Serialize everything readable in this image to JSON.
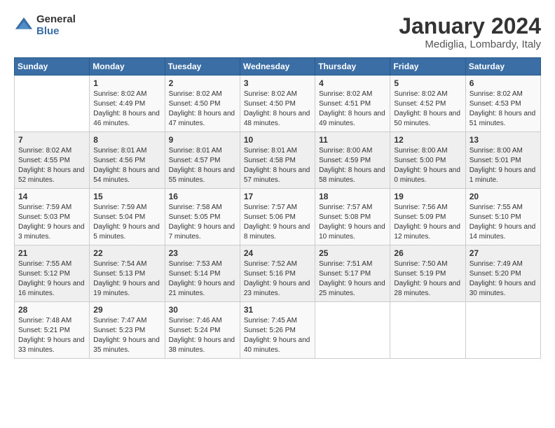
{
  "logo": {
    "general": "General",
    "blue": "Blue"
  },
  "header": {
    "month": "January 2024",
    "location": "Mediglia, Lombardy, Italy"
  },
  "weekdays": [
    "Sunday",
    "Monday",
    "Tuesday",
    "Wednesday",
    "Thursday",
    "Friday",
    "Saturday"
  ],
  "weeks": [
    [
      {
        "day": "",
        "sunrise": "",
        "sunset": "",
        "daylight": ""
      },
      {
        "day": "1",
        "sunrise": "Sunrise: 8:02 AM",
        "sunset": "Sunset: 4:49 PM",
        "daylight": "Daylight: 8 hours and 46 minutes."
      },
      {
        "day": "2",
        "sunrise": "Sunrise: 8:02 AM",
        "sunset": "Sunset: 4:50 PM",
        "daylight": "Daylight: 8 hours and 47 minutes."
      },
      {
        "day": "3",
        "sunrise": "Sunrise: 8:02 AM",
        "sunset": "Sunset: 4:50 PM",
        "daylight": "Daylight: 8 hours and 48 minutes."
      },
      {
        "day": "4",
        "sunrise": "Sunrise: 8:02 AM",
        "sunset": "Sunset: 4:51 PM",
        "daylight": "Daylight: 8 hours and 49 minutes."
      },
      {
        "day": "5",
        "sunrise": "Sunrise: 8:02 AM",
        "sunset": "Sunset: 4:52 PM",
        "daylight": "Daylight: 8 hours and 50 minutes."
      },
      {
        "day": "6",
        "sunrise": "Sunrise: 8:02 AM",
        "sunset": "Sunset: 4:53 PM",
        "daylight": "Daylight: 8 hours and 51 minutes."
      }
    ],
    [
      {
        "day": "7",
        "sunrise": "Sunrise: 8:02 AM",
        "sunset": "Sunset: 4:55 PM",
        "daylight": "Daylight: 8 hours and 52 minutes."
      },
      {
        "day": "8",
        "sunrise": "Sunrise: 8:01 AM",
        "sunset": "Sunset: 4:56 PM",
        "daylight": "Daylight: 8 hours and 54 minutes."
      },
      {
        "day": "9",
        "sunrise": "Sunrise: 8:01 AM",
        "sunset": "Sunset: 4:57 PM",
        "daylight": "Daylight: 8 hours and 55 minutes."
      },
      {
        "day": "10",
        "sunrise": "Sunrise: 8:01 AM",
        "sunset": "Sunset: 4:58 PM",
        "daylight": "Daylight: 8 hours and 57 minutes."
      },
      {
        "day": "11",
        "sunrise": "Sunrise: 8:00 AM",
        "sunset": "Sunset: 4:59 PM",
        "daylight": "Daylight: 8 hours and 58 minutes."
      },
      {
        "day": "12",
        "sunrise": "Sunrise: 8:00 AM",
        "sunset": "Sunset: 5:00 PM",
        "daylight": "Daylight: 9 hours and 0 minutes."
      },
      {
        "day": "13",
        "sunrise": "Sunrise: 8:00 AM",
        "sunset": "Sunset: 5:01 PM",
        "daylight": "Daylight: 9 hours and 1 minute."
      }
    ],
    [
      {
        "day": "14",
        "sunrise": "Sunrise: 7:59 AM",
        "sunset": "Sunset: 5:03 PM",
        "daylight": "Daylight: 9 hours and 3 minutes."
      },
      {
        "day": "15",
        "sunrise": "Sunrise: 7:59 AM",
        "sunset": "Sunset: 5:04 PM",
        "daylight": "Daylight: 9 hours and 5 minutes."
      },
      {
        "day": "16",
        "sunrise": "Sunrise: 7:58 AM",
        "sunset": "Sunset: 5:05 PM",
        "daylight": "Daylight: 9 hours and 7 minutes."
      },
      {
        "day": "17",
        "sunrise": "Sunrise: 7:57 AM",
        "sunset": "Sunset: 5:06 PM",
        "daylight": "Daylight: 9 hours and 8 minutes."
      },
      {
        "day": "18",
        "sunrise": "Sunrise: 7:57 AM",
        "sunset": "Sunset: 5:08 PM",
        "daylight": "Daylight: 9 hours and 10 minutes."
      },
      {
        "day": "19",
        "sunrise": "Sunrise: 7:56 AM",
        "sunset": "Sunset: 5:09 PM",
        "daylight": "Daylight: 9 hours and 12 minutes."
      },
      {
        "day": "20",
        "sunrise": "Sunrise: 7:55 AM",
        "sunset": "Sunset: 5:10 PM",
        "daylight": "Daylight: 9 hours and 14 minutes."
      }
    ],
    [
      {
        "day": "21",
        "sunrise": "Sunrise: 7:55 AM",
        "sunset": "Sunset: 5:12 PM",
        "daylight": "Daylight: 9 hours and 16 minutes."
      },
      {
        "day": "22",
        "sunrise": "Sunrise: 7:54 AM",
        "sunset": "Sunset: 5:13 PM",
        "daylight": "Daylight: 9 hours and 19 minutes."
      },
      {
        "day": "23",
        "sunrise": "Sunrise: 7:53 AM",
        "sunset": "Sunset: 5:14 PM",
        "daylight": "Daylight: 9 hours and 21 minutes."
      },
      {
        "day": "24",
        "sunrise": "Sunrise: 7:52 AM",
        "sunset": "Sunset: 5:16 PM",
        "daylight": "Daylight: 9 hours and 23 minutes."
      },
      {
        "day": "25",
        "sunrise": "Sunrise: 7:51 AM",
        "sunset": "Sunset: 5:17 PM",
        "daylight": "Daylight: 9 hours and 25 minutes."
      },
      {
        "day": "26",
        "sunrise": "Sunrise: 7:50 AM",
        "sunset": "Sunset: 5:19 PM",
        "daylight": "Daylight: 9 hours and 28 minutes."
      },
      {
        "day": "27",
        "sunrise": "Sunrise: 7:49 AM",
        "sunset": "Sunset: 5:20 PM",
        "daylight": "Daylight: 9 hours and 30 minutes."
      }
    ],
    [
      {
        "day": "28",
        "sunrise": "Sunrise: 7:48 AM",
        "sunset": "Sunset: 5:21 PM",
        "daylight": "Daylight: 9 hours and 33 minutes."
      },
      {
        "day": "29",
        "sunrise": "Sunrise: 7:47 AM",
        "sunset": "Sunset: 5:23 PM",
        "daylight": "Daylight: 9 hours and 35 minutes."
      },
      {
        "day": "30",
        "sunrise": "Sunrise: 7:46 AM",
        "sunset": "Sunset: 5:24 PM",
        "daylight": "Daylight: 9 hours and 38 minutes."
      },
      {
        "day": "31",
        "sunrise": "Sunrise: 7:45 AM",
        "sunset": "Sunset: 5:26 PM",
        "daylight": "Daylight: 9 hours and 40 minutes."
      },
      {
        "day": "",
        "sunrise": "",
        "sunset": "",
        "daylight": ""
      },
      {
        "day": "",
        "sunrise": "",
        "sunset": "",
        "daylight": ""
      },
      {
        "day": "",
        "sunrise": "",
        "sunset": "",
        "daylight": ""
      }
    ]
  ]
}
